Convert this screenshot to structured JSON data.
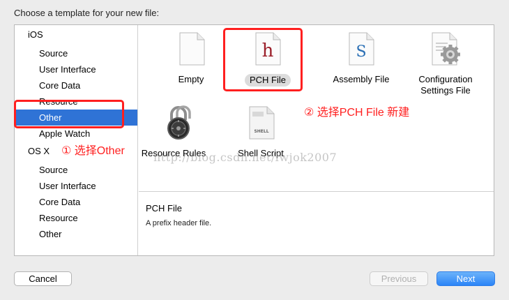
{
  "dialog": {
    "prompt": "Choose a template for your new file:"
  },
  "sidebar": {
    "ios_header": "iOS",
    "ios_items": [
      "Source",
      "User Interface",
      "Core Data",
      "Resource",
      "Other",
      "Apple Watch"
    ],
    "osx_header": "OS X",
    "osx_items": [
      "Source",
      "User Interface",
      "Core Data",
      "Resource",
      "Other"
    ],
    "selected": "Other"
  },
  "templates": {
    "empty": "Empty",
    "pch": "PCH File",
    "assembly": "Assembly File",
    "configuration": "Configuration\nSettings File",
    "resource_rules": "Resource Rules",
    "shell_script": "Shell Script"
  },
  "icons": {
    "pch_glyph": "h",
    "assembly_glyph": "S",
    "shell_glyph": "SHELL"
  },
  "description": {
    "title": "PCH File",
    "text": "A prefix header file."
  },
  "buttons": {
    "cancel": "Cancel",
    "previous": "Previous",
    "next": "Next"
  },
  "annotations": {
    "step1": "① 选择Other",
    "step2": "② 选择PCH File 新建"
  },
  "watermark": "http://blog.csdn.net/lwjok2007",
  "colors": {
    "selection": "#2f73d6",
    "annotation_red": "#ff1f1f",
    "next_button": "#2b84f7"
  }
}
